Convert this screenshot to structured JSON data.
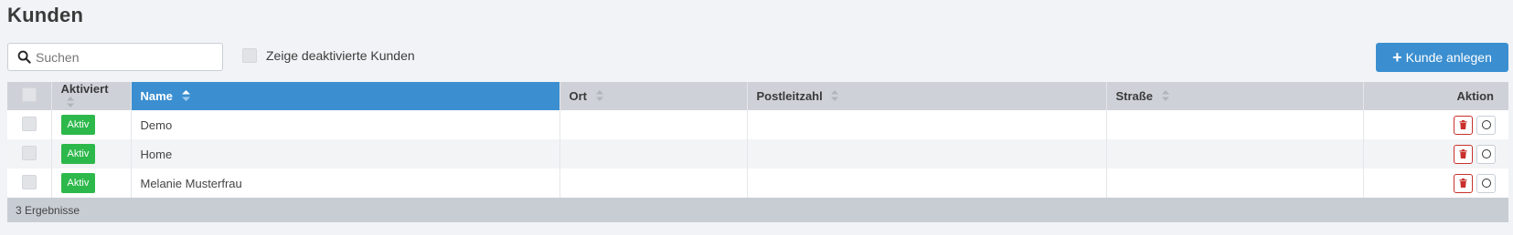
{
  "page": {
    "title": "Kunden"
  },
  "toolbar": {
    "search_placeholder": "Suchen",
    "search_value": "",
    "show_deactivated_label": "Zeige deaktivierte Kunden",
    "add_button_label": "Kunde anlegen",
    "add_button_color": "#3b8fd0"
  },
  "table": {
    "columns": [
      {
        "label": "Aktiviert"
      },
      {
        "label": "Name"
      },
      {
        "label": "Ort"
      },
      {
        "label": "Postleitzahl"
      },
      {
        "label": "Straße"
      },
      {
        "label": "Aktion"
      }
    ],
    "sorted_column": "Name",
    "rows": [
      {
        "status": "Aktiv",
        "name": "Demo",
        "ort": "",
        "plz": "",
        "strasse": ""
      },
      {
        "status": "Aktiv",
        "name": "Home",
        "ort": "",
        "plz": "",
        "strasse": ""
      },
      {
        "status": "Aktiv",
        "name": "Melanie Musterfrau",
        "ort": "",
        "plz": "",
        "strasse": ""
      }
    ],
    "footer_text": "3 Ergebnisse",
    "status_color": "#2db84b",
    "delete_color": "#c9302c"
  }
}
